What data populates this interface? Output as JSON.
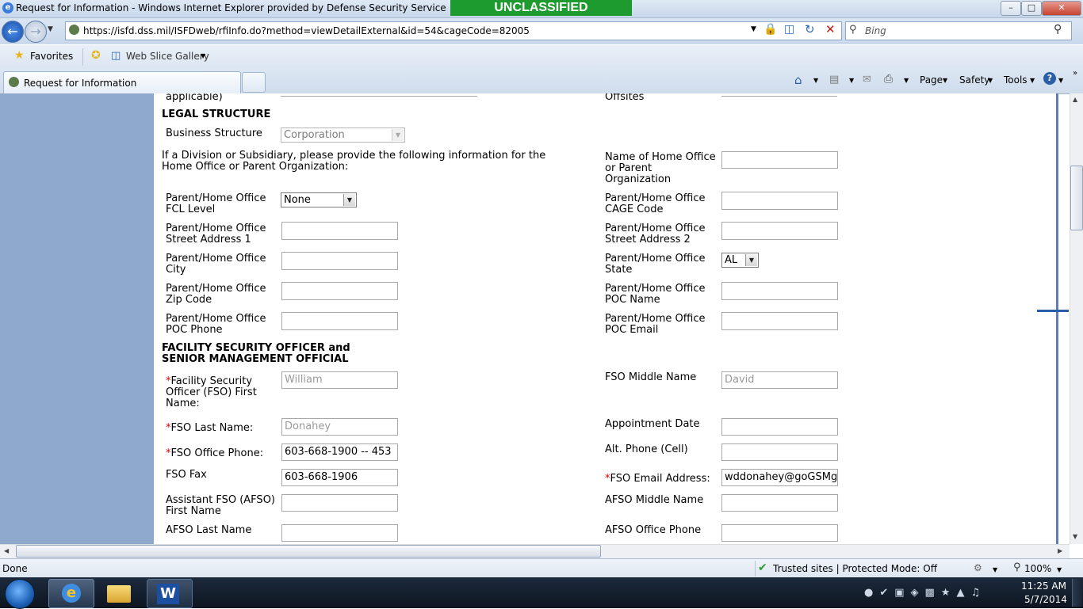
{
  "window": {
    "title": "Request for Information - Windows Internet Explorer provided by Defense Security Service",
    "classification": "UNCLASSIFIED",
    "min_icon": "minimize-icon",
    "max_icon": "maximize-icon",
    "close_icon": "close-icon"
  },
  "nav": {
    "url": "https://isfd.dss.mil/ISFDweb/rfiInfo.do?method=viewDetailExternal&id=54&cageCode=82005",
    "search_placeholder": "Bing"
  },
  "favorites": {
    "favorites_label": "Favorites",
    "web_slice_label": "Web Slice Gallery"
  },
  "tabs": {
    "active_tab": "Request for Information"
  },
  "commandbar": {
    "page": "Page",
    "safety": "Safety",
    "tools": "Tools"
  },
  "form": {
    "prev_label_tail": "applicable)",
    "prev_right_label_tail": "Offsites",
    "legal_heading": "LEGAL STRUCTURE",
    "business_structure_label": "Business Structure",
    "business_structure_value": "Corporation",
    "division_note": "If a Division or Subsidiary, please provide the following information for the Home Office or Parent Organization:",
    "home_office_name_label": "Name of Home Office or Parent Organization",
    "fcl_level_label": "Parent/Home Office FCL Level",
    "fcl_level_value": "None",
    "cage_code_label": "Parent/Home Office CAGE Code",
    "street1_label": "Parent/Home Office Street Address 1",
    "street2_label": "Parent/Home Office Street Address 2",
    "city_label": "Parent/Home Office City",
    "state_label": "Parent/Home Office State",
    "state_value": "AL",
    "zip_label": "Parent/Home Office Zip Code",
    "poc_name_label": "Parent/Home Office POC Name",
    "poc_phone_label": "Parent/Home Office POC Phone",
    "poc_email_label": "Parent/Home Office POC Email",
    "fso_heading_1": "FACILITY SECURITY OFFICER and",
    "fso_heading_2": "SENIOR MANAGEMENT OFFICIAL",
    "fso_first_label": "Facility Security Officer (FSO) First Name:",
    "fso_first_value": "William",
    "fso_middle_label": "FSO Middle Name",
    "fso_middle_value": "David",
    "fso_last_label": "FSO Last Name:",
    "fso_last_value": "Donahey",
    "appointment_label": "Appointment Date",
    "fso_phone_label": "FSO Office Phone:",
    "fso_phone_value": "603-668-1900 -- 453",
    "alt_phone_label": "Alt. Phone (Cell)",
    "fso_fax_label": "FSO Fax",
    "fso_fax_value": "603-668-1906",
    "fso_email_label": "FSO Email Address:",
    "fso_email_value": "wddonahey@goGSMgc",
    "afso_first_label": "Assistant FSO (AFSO) First Name",
    "afso_middle_label": "AFSO Middle Name",
    "afso_last_label": "AFSO Last Name",
    "afso_phone_label": "AFSO Office Phone",
    "required_mark": "*"
  },
  "status": {
    "done": "Done",
    "zone": "Trusted sites | Protected Mode: Off",
    "zoom": "100%"
  },
  "taskbar": {
    "time": "11:25 AM",
    "date": "5/7/2014"
  }
}
